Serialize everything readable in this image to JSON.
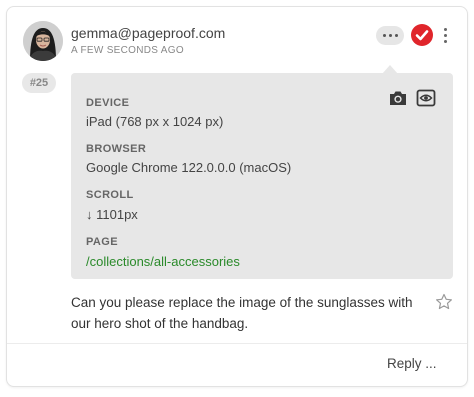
{
  "comment": {
    "author": "gemma@pageproof.com",
    "timestamp": "A FEW SECONDS AGO",
    "pin_number": "#25",
    "text": "Can you please replace the image of the sunglasses with our hero shot of the handbag.",
    "reply_label": "Reply ..."
  },
  "metadata": {
    "device_label": "DEVICE",
    "device_value": "iPad (768 px x 1024 px)",
    "browser_label": "BROWSER",
    "browser_value": "Google Chrome 122.0.0.0 (macOS)",
    "scroll_label": "SCROLL",
    "scroll_value": "↓ 1101px",
    "page_label": "PAGE",
    "page_value": "/collections/all-accessories"
  },
  "icons": {
    "more": "more-horizontal-icon",
    "approve": "check-circle-icon",
    "kebab": "more-vertical-icon",
    "camera": "camera-icon",
    "preview": "eye-frame-icon",
    "star": "star-outline-icon"
  },
  "colors": {
    "approve_red": "#e0252b",
    "link_green": "#2a8a2a",
    "panel_gray": "#e7e7e7"
  }
}
